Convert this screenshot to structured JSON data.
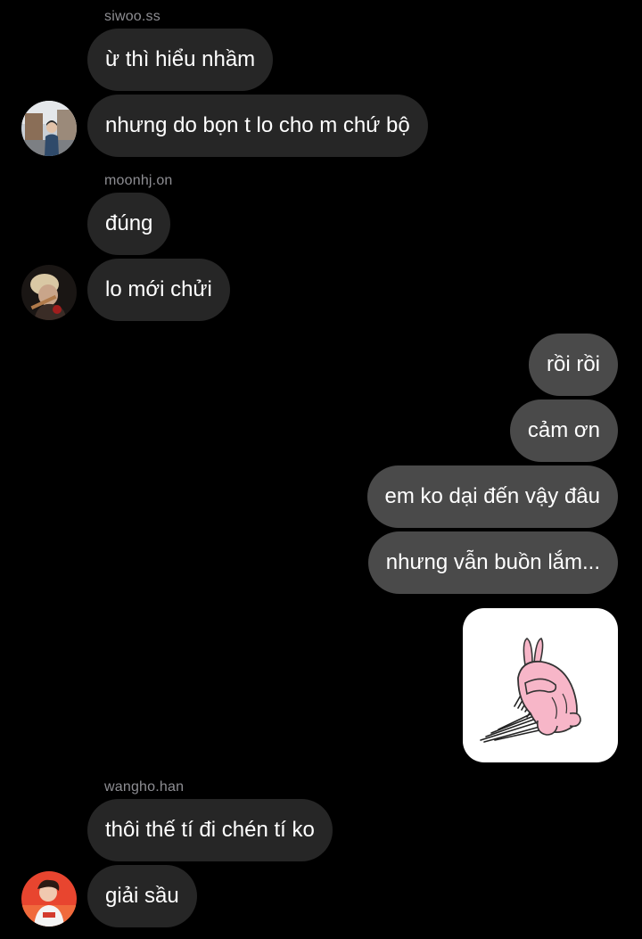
{
  "conversation": [
    {
      "sender": "siwoo.ss",
      "messages": [
        "ừ thì hiểu nhầm",
        "nhưng do bọn t lo cho m chứ bộ"
      ],
      "avatar": "siwoo-avatar"
    },
    {
      "sender": "moonhj.on",
      "messages": [
        "đúng",
        "lo mới chửi"
      ],
      "avatar": "moonhj-avatar"
    },
    {
      "sender": "me",
      "messages": [
        "rồi rồi",
        "cảm ơn",
        "em ko dại đến vậy đâu",
        "nhưng vẫn buồn lắm..."
      ],
      "sticker": "sad-pink-rabbit-sticker"
    },
    {
      "sender": "wangho.han",
      "messages": [
        "thôi thế tí đi chén tí ko",
        "giải sầu"
      ],
      "avatar": "wangho-avatar"
    }
  ],
  "colors": {
    "background": "#000000",
    "incoming_bubble": "#262626",
    "outgoing_bubble": "#4a4a4a",
    "sender_name": "#8e8e93",
    "sticker_rabbit": "#f7b6c8"
  }
}
